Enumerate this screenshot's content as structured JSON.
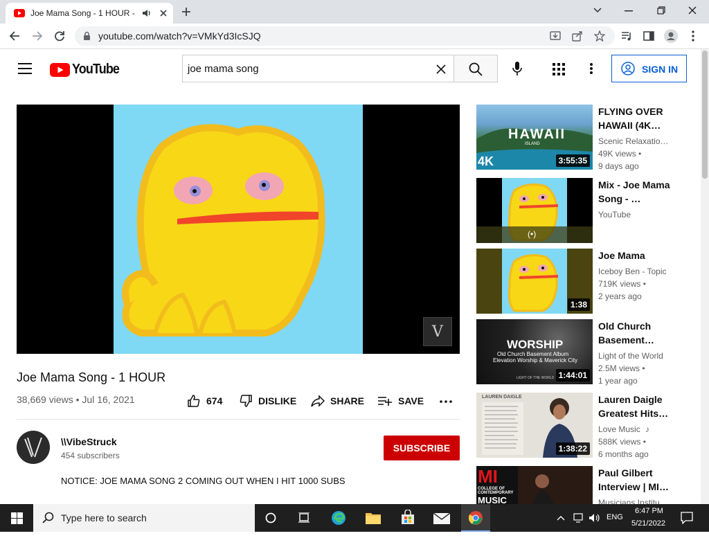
{
  "browser": {
    "tab_title": "Joe Mama Song - 1 HOUR -",
    "url": "youtube.com/watch?v=VMkYd3IcSJQ"
  },
  "header": {
    "logo_text": "YouTube",
    "search_value": "joe mama song",
    "sign_in": "SIGN IN"
  },
  "video": {
    "title": "Joe Mama Song - 1 HOUR",
    "views": "38,669 views",
    "date": "Jul 16, 2021",
    "likes": "674",
    "dislike": "DISLIKE",
    "share": "SHARE",
    "save": "SAVE",
    "watermark_letter": "V"
  },
  "channel": {
    "name": "\\\\VibeStruck",
    "subscribers": "454 subscribers",
    "subscribe": "SUBSCRIBE",
    "description": "NOTICE: JOE MAMA SONG 2 COMING OUT WHEN I HIT 1000 SUBS"
  },
  "recommendations": [
    {
      "title": "FLYING OVER HAWAII (4K…",
      "channel": "Scenic Relaxatio…",
      "views": "49K views •",
      "age": "9 days ago",
      "duration": "3:55:35",
      "thumb_text": "HAWAII",
      "thumb_sub": "ISLAND",
      "thumb_badge": "4K"
    },
    {
      "title": "Mix - Joe Mama Song - …",
      "channel": "YouTube",
      "views": "",
      "age": "",
      "duration": "",
      "thumb_icon": "(•)"
    },
    {
      "title": "Joe Mama",
      "channel": "Iceboy Ben - Topic",
      "views": "719K views •",
      "age": "2 years ago",
      "duration": "1:38"
    },
    {
      "title": "Old Church Basement…",
      "channel": "Light of the World",
      "views": "2.5M views •",
      "age": "1 year ago",
      "duration": "1:44:01",
      "thumb_text": "WORSHIP",
      "thumb_sub": "Old Church Basement Album",
      "thumb_sub2": "Elevation Worship & Maverick City",
      "thumb_foot": "LIGHT OF THE WORLD"
    },
    {
      "title": "Lauren Daigle Greatest Hits…",
      "channel": "Love Music",
      "views": "588K views •",
      "age": "6 months ago",
      "duration": "1:38:22",
      "thumb_text": "LAUREN DAIGLE"
    },
    {
      "title": "Paul Gilbert Interview | MI…",
      "channel": "Musicians Institu…",
      "views": "",
      "age": "",
      "duration": "",
      "thumb_text": "MI",
      "thumb_sub": "COLLEGE OF CONTEMPORARY",
      "thumb_sub2": "MUSIC"
    }
  ],
  "taskbar": {
    "search_placeholder": "Type here to search",
    "lang": "ENG",
    "time": "6:47 PM",
    "date": "5/21/2022"
  },
  "colors": {
    "youtube_red": "#ff0000",
    "subscribe_red": "#cc0000",
    "link_blue": "#065fd4",
    "video_bg": "#7fd8f4",
    "blob_yellow": "#f7d716"
  }
}
